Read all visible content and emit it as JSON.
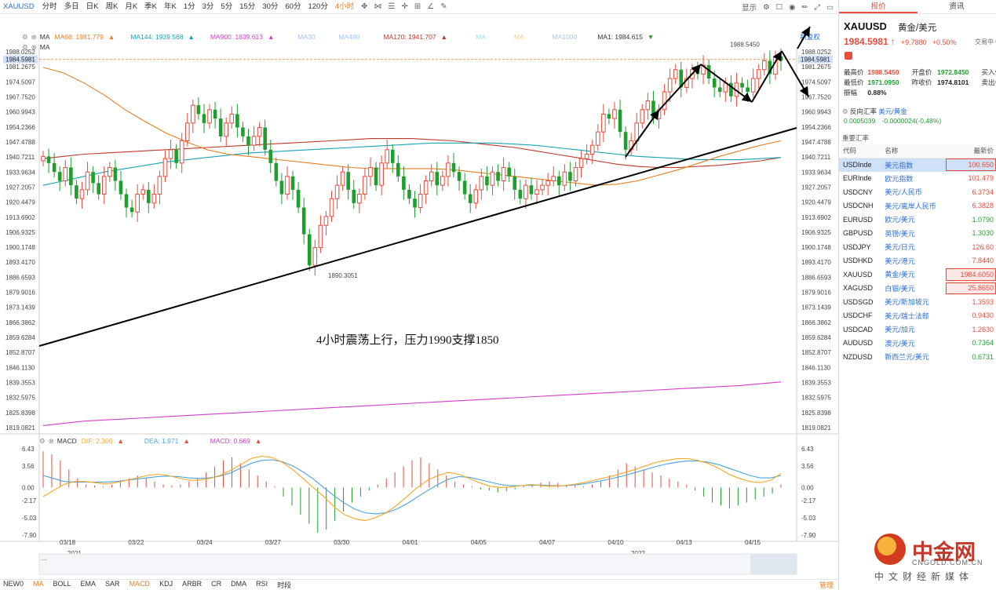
{
  "toolbar": {
    "symbol": "XAUUSD",
    "periods": [
      "分时",
      "多日",
      "日K",
      "周K",
      "月K",
      "季K",
      "年K",
      "1分",
      "3分",
      "5分",
      "15分",
      "30分",
      "60分",
      "120分",
      "4小时"
    ],
    "active_period": "4小时",
    "right_label": "显示"
  },
  "legend_main": {
    "ma_label": "MA",
    "ma66": "MA66: 1981.779",
    "ma144": "MA144: 1939.568",
    "ma900": "MA900: 1839.613",
    "ma30": "MA30",
    "ma480": "MA480",
    "ma120": "MA120: 1941.707",
    "ma1000": "MA1000",
    "ma1": "MA1: 1984.615",
    "new_label": "新复权"
  },
  "legend_macd": {
    "label": "MACD",
    "dif": "DIF: 2.306",
    "dea": "DEA: 1.971",
    "macd": "MACD: 0.669"
  },
  "colors": {
    "up": "#e74c3c",
    "down": "#1e9e2e",
    "ma66": "#e67e22",
    "ma144": "#17a2b8",
    "ma120": "#c0392b",
    "ma900": "#d63dc8",
    "dif": "#f5a623",
    "dea": "#4aa3df"
  },
  "chart_data": [
    {
      "type": "candlestick",
      "symbol": "XAUUSD",
      "period": "4小时",
      "y_ticks": [
        "1988.0252",
        "1981.2675",
        "1974.5097",
        "1967.7520",
        "1960.9943",
        "1954.2366",
        "1947.4788",
        "1940.7211",
        "1933.9634",
        "1927.2057",
        "1920.4479",
        "1913.6902",
        "1906.9325",
        "1900.1748",
        "1893.4170",
        "1886.6593",
        "1879.9016",
        "1873.1439",
        "1866.3862",
        "1859.6284",
        "1852.8707",
        "1846.1130",
        "1839.3553",
        "1832.5975",
        "1825.8398",
        "1819.0821"
      ],
      "ylim": [
        1819.0821,
        1988.0252
      ],
      "last_price": "1984.5981",
      "x_ticks": [
        "03/18",
        "03/22",
        "03/24",
        "03/27",
        "03/30",
        "04/01",
        "04/05",
        "04/07",
        "04/10",
        "04/13",
        "04/15"
      ],
      "years": [
        "2021",
        "2022"
      ],
      "annotations": [
        "1890.3051",
        "1988.5450",
        "4小时震荡上行，压力1990支撑1850"
      ],
      "closes": [
        1941,
        1938,
        1934,
        1930,
        1936,
        1928,
        1922,
        1926,
        1934,
        1929,
        1924,
        1932,
        1936,
        1930,
        1924,
        1918,
        1916,
        1924,
        1926,
        1920,
        1924,
        1932,
        1940,
        1944,
        1938,
        1948,
        1956,
        1964,
        1960,
        1956,
        1962,
        1958,
        1950,
        1956,
        1960,
        1954,
        1950,
        1946,
        1950,
        1954,
        1944,
        1938,
        1930,
        1924,
        1932,
        1926,
        1918,
        1906,
        1892,
        1900,
        1910,
        1914,
        1922,
        1928,
        1934,
        1926,
        1920,
        1924,
        1932,
        1936,
        1928,
        1938,
        1944,
        1938,
        1932,
        1926,
        1922,
        1918,
        1924,
        1930,
        1934,
        1928,
        1932,
        1938,
        1934,
        1930,
        1924,
        1920,
        1926,
        1932,
        1928,
        1934,
        1930,
        1936,
        1932,
        1926,
        1922,
        1928,
        1924,
        1926,
        1928,
        1930,
        1932,
        1928,
        1934,
        1930,
        1936,
        1940,
        1942,
        1946,
        1952,
        1960,
        1958,
        1962,
        1952,
        1944,
        1948,
        1956,
        1962,
        1966,
        1958,
        1962,
        1970,
        1976,
        1980,
        1972,
        1976,
        1980,
        1978,
        1982,
        1976,
        1972,
        1970,
        1974,
        1968,
        1974,
        1972,
        1970,
        1976,
        1980,
        1984,
        1978,
        1986,
        1984
      ],
      "ma66": [
        1981.0,
        1978.5,
        1974.0,
        1968.5,
        1962.0,
        1956.5,
        1951.5,
        1947.5,
        1944.0,
        1942.0,
        1941.0,
        1940.0,
        1939.0,
        1938.0,
        1937.0,
        1936.0,
        1935.5,
        1935.5,
        1935.5,
        1935.5,
        1935.0,
        1934.0,
        1933.0,
        1932.0,
        1931.0,
        1930.0,
        1929.0,
        1928.0,
        1928.5,
        1930.0,
        1932.5,
        1935.0,
        1938.0,
        1941.0,
        1943.5,
        1946.0,
        1948.0
      ],
      "ma144": [
        1928.0,
        1930.0,
        1932.0,
        1934.0,
        1935.5,
        1937.0,
        1938.5,
        1939.5,
        1940.5,
        1941.5,
        1942.5,
        1943.0,
        1943.5,
        1944.0,
        1944.5,
        1945.0,
        1945.5,
        1946.0,
        1946.5,
        1947.0,
        1947.0,
        1947.0,
        1947.0,
        1946.5,
        1946.0,
        1945.0,
        1944.0,
        1943.0,
        1942.0,
        1941.0,
        1940.5,
        1940.0,
        1939.5,
        1939.5,
        1939.5,
        1940.0,
        1940.5
      ],
      "ma120": [
        1940.0,
        1941.0,
        1942.0,
        1942.5,
        1943.0,
        1943.5,
        1944.0,
        1944.5,
        1945.0,
        1945.5,
        1946.0,
        1946.5,
        1947.0,
        1947.5,
        1948.0,
        1948.5,
        1949.0,
        1949.0,
        1949.0,
        1948.5,
        1948.0,
        1947.0,
        1946.0,
        1945.0,
        1943.5,
        1942.0,
        1940.5,
        1939.0,
        1937.5,
        1936.5,
        1936.0,
        1936.0,
        1936.5,
        1937.0,
        1938.0,
        1939.0,
        1940.5
      ],
      "ma900": [
        1820.0,
        1821.0,
        1822.0,
        1822.5,
        1823.0,
        1823.5,
        1824.0,
        1824.5,
        1825.0,
        1825.5,
        1826.0,
        1826.5,
        1827.0,
        1827.5,
        1828.0,
        1828.5,
        1829.0,
        1829.5,
        1830.0,
        1830.5,
        1831.0,
        1831.5,
        1832.0,
        1832.5,
        1833.0,
        1833.5,
        1834.0,
        1834.5,
        1835.0,
        1835.5,
        1836.0,
        1836.5,
        1837.0,
        1837.5,
        1838.0,
        1838.8,
        1839.6
      ]
    },
    {
      "type": "macd",
      "y_ticks": [
        "6.43",
        "3.56",
        "0.00",
        "-2.17",
        "-5.03",
        "-7.90"
      ],
      "ylim": [
        -7.9,
        6.43
      ],
      "hist": [
        6.0,
        5.5,
        4.5,
        3.0,
        1.5,
        0.5,
        0.3,
        0.2,
        0.5,
        1.0,
        1.5,
        2.0,
        1.5,
        1.0,
        0.5,
        0.3,
        0.5,
        1.0,
        1.5,
        2.5,
        3.5,
        4.5,
        5.0,
        4.0,
        3.0,
        2.0,
        1.0,
        0.2,
        -1.5,
        -3.0,
        -4.5,
        -6.0,
        -7.5,
        -7.0,
        -5.5,
        -4.0,
        -2.5,
        -1.5,
        -0.5,
        0.5,
        1.5,
        2.5,
        3.5,
        4.5,
        5.0,
        4.0,
        3.0,
        2.0,
        1.0,
        0.5,
        0.2,
        -0.3,
        -0.5,
        -0.8,
        -0.6,
        -0.3,
        0.2,
        0.5,
        0.8,
        1.0,
        0.8,
        0.5,
        0.3,
        0.2,
        0.5,
        1.0,
        2.0,
        3.0,
        4.0,
        3.5,
        3.0,
        2.5,
        2.0,
        1.5,
        1.0,
        0.5,
        -0.5,
        -1.5,
        -2.5,
        -3.0,
        -3.5,
        -3.0,
        -2.5,
        -2.0,
        -1.5,
        -1.0,
        0.5
      ],
      "dif": [
        -1.5,
        -0.5,
        0.5,
        1.0,
        1.0,
        0.8,
        0.6,
        0.8,
        1.2,
        1.6,
        2.0,
        2.2,
        2.0,
        1.6,
        1.2,
        1.2,
        1.5,
        2.0,
        2.8,
        3.8,
        4.8,
        5.2,
        5.0,
        4.2,
        3.0,
        1.5,
        0.0,
        -1.5,
        -3.2,
        -4.5,
        -5.2,
        -5.5,
        -5.0,
        -4.2,
        -3.0,
        -1.5,
        0.0,
        1.2,
        2.0,
        2.5,
        2.2,
        1.5,
        0.8,
        0.2,
        0.0,
        0.1,
        0.3,
        0.5,
        0.3,
        0.2,
        0.3,
        0.5,
        0.8,
        1.2,
        1.6,
        2.0,
        2.5,
        3.0,
        3.6,
        4.2,
        4.5,
        4.8,
        4.8,
        4.5,
        4.0,
        3.2,
        2.2,
        1.5,
        1.0,
        0.8,
        1.2,
        2.3
      ],
      "dea": [
        2.0,
        1.5,
        1.0,
        0.9,
        0.9,
        0.9,
        0.9,
        1.0,
        1.2,
        1.4,
        1.6,
        1.8,
        1.9,
        1.8,
        1.6,
        1.5,
        1.6,
        1.9,
        2.4,
        3.2,
        4.0,
        4.5,
        4.6,
        4.3,
        3.6,
        2.6,
        1.4,
        0.0,
        -1.4,
        -2.6,
        -3.6,
        -4.2,
        -4.4,
        -4.2,
        -3.6,
        -2.7,
        -1.6,
        -0.5,
        0.5,
        1.4,
        1.8,
        1.7,
        1.3,
        0.9,
        0.5,
        0.3,
        0.3,
        0.4,
        0.4,
        0.3,
        0.3,
        0.4,
        0.6,
        0.9,
        1.2,
        1.6,
        2.0,
        2.5,
        3.0,
        3.5,
        3.9,
        4.2,
        4.4,
        4.4,
        4.2,
        3.8,
        3.2,
        2.6,
        2.0,
        1.6,
        1.6,
        2.0
      ]
    }
  ],
  "bottom_bar": {
    "items": [
      "NEW0",
      "MA",
      "BOLL",
      "EMA",
      "SAR",
      "MACD",
      "KDJ",
      "ARBR",
      "CR",
      "DMA",
      "RSI",
      "时段"
    ],
    "active": [
      "MA",
      "MACD"
    ],
    "right_label": "管理"
  },
  "right_panel": {
    "tabs": [
      "报价",
      "资讯"
    ],
    "active_tab": "报价",
    "symbol": "XAUUSD",
    "name": "黄金/美元",
    "price": "1984.5981",
    "change": "+9.7880",
    "change_pct": "+0.50%",
    "time_label": "交易中 04/1",
    "quote": {
      "high_lbl": "最高价",
      "high": "1988.5450",
      "open_lbl": "开盘价",
      "open": "1972.8450",
      "buy_lbl": "买入价",
      "low_lbl": "最低价",
      "low": "1971.0950",
      "prev_lbl": "昨收价",
      "prev": "1974.8101",
      "sell_lbl": "卖出价",
      "amp_lbl": "振幅",
      "amp": "0.88%"
    },
    "reverse": {
      "label": "反向汇率",
      "pair": "美元/黄金",
      "value": "0.0005039",
      "change": "-0.0000024(-0.48%)"
    },
    "section_title": "重要汇率",
    "table_headers": [
      "代码",
      "名称",
      "最新价"
    ],
    "rows": [
      {
        "code": "USDInde",
        "name": "美元指数",
        "price": "100.650",
        "color": "red",
        "sel": true,
        "box": true
      },
      {
        "code": "EURInde",
        "name": "欧元指数",
        "price": "101.479",
        "color": "red"
      },
      {
        "code": "USDCNY",
        "name": "美元/人民币",
        "price": "6.3734",
        "color": "red"
      },
      {
        "code": "USDCNH",
        "name": "美元/离岸人民币",
        "price": "6.3828",
        "color": "red"
      },
      {
        "code": "EURUSD",
        "name": "欧元/美元",
        "price": "1.0790",
        "color": "green"
      },
      {
        "code": "GBPUSD",
        "name": "英镑/美元",
        "price": "1.3030",
        "color": "green"
      },
      {
        "code": "USDJPY",
        "name": "美元/日元",
        "price": "126.60",
        "color": "red"
      },
      {
        "code": "USDHKD",
        "name": "美元/港元",
        "price": "7.8440",
        "color": "red"
      },
      {
        "code": "XAUUSD",
        "name": "黄金/美元",
        "price": "1984.6050",
        "color": "red",
        "box": true
      },
      {
        "code": "XAGUSD",
        "name": "白银/美元",
        "price": "25.8650",
        "color": "red",
        "box": true
      },
      {
        "code": "USDSGD",
        "name": "美元/新加坡元",
        "price": "1.3593",
        "color": "red"
      },
      {
        "code": "USDCHF",
        "name": "美元/瑞士法郎",
        "price": "0.9430",
        "color": "red"
      },
      {
        "code": "USDCAD",
        "name": "美元/加元",
        "price": "1.2630",
        "color": "red"
      },
      {
        "code": "AUDUSD",
        "name": "澳元/美元",
        "price": "0.7364",
        "color": "green"
      },
      {
        "code": "NZDUSD",
        "name": "新西兰元/美元",
        "price": "0.6731",
        "color": "green"
      }
    ]
  },
  "watermark": {
    "name": "中金网",
    "site": "CNGOLD.COM.CN",
    "slogan": "中文财经新媒体"
  }
}
